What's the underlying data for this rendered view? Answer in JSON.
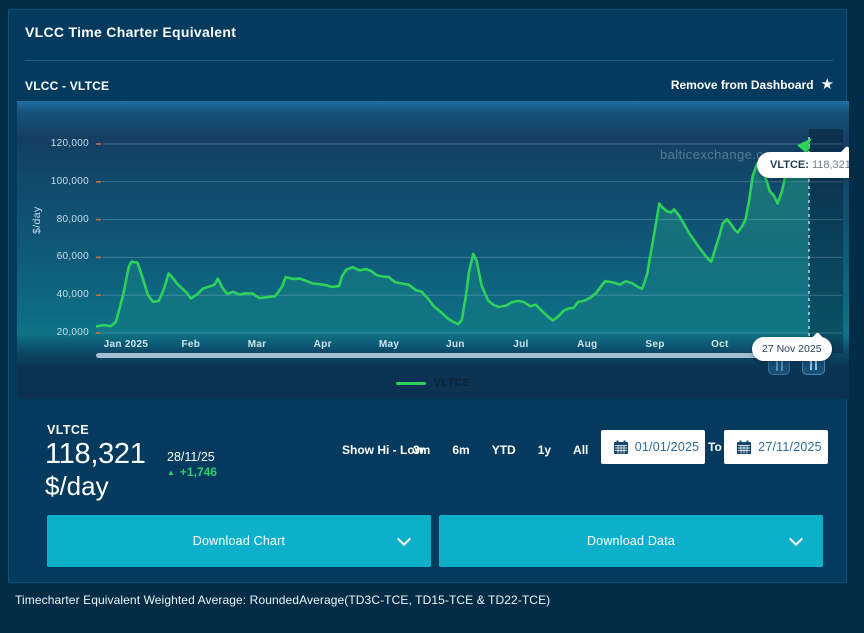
{
  "window": {
    "title": "VLCC Time Charter Equivalent"
  },
  "header": {
    "subtitle": "VLCC - VLTCE",
    "remove_label": "Remove from Dashboard",
    "star_icon": "★"
  },
  "chart_data": {
    "type": "line",
    "ylabel": "$/day",
    "ylim": [
      20000,
      120000
    ],
    "y_ticks": [
      20000,
      40000,
      60000,
      80000,
      100000,
      120000
    ],
    "x_ticks": [
      {
        "label": "Jan 2025",
        "f": 0.042
      },
      {
        "label": "Feb",
        "f": 0.133
      },
      {
        "label": "Mar",
        "f": 0.226
      },
      {
        "label": "Apr",
        "f": 0.318
      },
      {
        "label": "May",
        "f": 0.411
      },
      {
        "label": "Jun",
        "f": 0.504
      },
      {
        "label": "Jul",
        "f": 0.596
      },
      {
        "label": "Aug",
        "f": 0.689
      },
      {
        "label": "Sep",
        "f": 0.784
      },
      {
        "label": "Oct",
        "f": 0.875
      }
    ],
    "grid": true,
    "legend_position": "bottom",
    "watermark": "balticexchange.com",
    "line_color": "#2ed159",
    "area_color": "#2ed695",
    "tick_color": "#c4703f",
    "cursor_date": "27 Nov 2025",
    "tooltip": {
      "label": "VLTCE:",
      "value": "118,321"
    },
    "series": [
      {
        "name": "VLTCE",
        "points": [
          [
            0.0,
            23500
          ],
          [
            0.011,
            24200
          ],
          [
            0.021,
            23600
          ],
          [
            0.028,
            26000
          ],
          [
            0.038,
            40000
          ],
          [
            0.046,
            55000
          ],
          [
            0.05,
            57800
          ],
          [
            0.058,
            57200
          ],
          [
            0.063,
            52000
          ],
          [
            0.073,
            40000
          ],
          [
            0.08,
            36500
          ],
          [
            0.088,
            36900
          ],
          [
            0.095,
            43000
          ],
          [
            0.102,
            51500
          ],
          [
            0.108,
            49000
          ],
          [
            0.114,
            46000
          ],
          [
            0.121,
            43500
          ],
          [
            0.128,
            41000
          ],
          [
            0.133,
            38200
          ],
          [
            0.142,
            40500
          ],
          [
            0.15,
            43500
          ],
          [
            0.158,
            44500
          ],
          [
            0.166,
            45500
          ],
          [
            0.171,
            48800
          ],
          [
            0.177,
            44000
          ],
          [
            0.184,
            40600
          ],
          [
            0.192,
            41800
          ],
          [
            0.201,
            40300
          ],
          [
            0.21,
            41000
          ],
          [
            0.22,
            40800
          ],
          [
            0.229,
            38400
          ],
          [
            0.24,
            39000
          ],
          [
            0.251,
            39300
          ],
          [
            0.261,
            44500
          ],
          [
            0.266,
            49500
          ],
          [
            0.276,
            48600
          ],
          [
            0.286,
            48800
          ],
          [
            0.295,
            47500
          ],
          [
            0.304,
            46200
          ],
          [
            0.313,
            45800
          ],
          [
            0.323,
            45300
          ],
          [
            0.331,
            44400
          ],
          [
            0.341,
            44800
          ],
          [
            0.345,
            50000
          ],
          [
            0.351,
            53500
          ],
          [
            0.36,
            54800
          ],
          [
            0.369,
            53200
          ],
          [
            0.379,
            53800
          ],
          [
            0.386,
            52800
          ],
          [
            0.394,
            50500
          ],
          [
            0.404,
            49800
          ],
          [
            0.411,
            49600
          ],
          [
            0.419,
            47000
          ],
          [
            0.429,
            46200
          ],
          [
            0.439,
            45500
          ],
          [
            0.449,
            42600
          ],
          [
            0.457,
            41800
          ],
          [
            0.466,
            38000
          ],
          [
            0.474,
            34000
          ],
          [
            0.484,
            31000
          ],
          [
            0.494,
            27500
          ],
          [
            0.501,
            26000
          ],
          [
            0.508,
            24600
          ],
          [
            0.513,
            27000
          ],
          [
            0.519,
            40000
          ],
          [
            0.523,
            52000
          ],
          [
            0.529,
            61800
          ],
          [
            0.534,
            58000
          ],
          [
            0.541,
            45000
          ],
          [
            0.55,
            37200
          ],
          [
            0.557,
            35000
          ],
          [
            0.565,
            33800
          ],
          [
            0.575,
            34500
          ],
          [
            0.583,
            36200
          ],
          [
            0.592,
            37000
          ],
          [
            0.6,
            36400
          ],
          [
            0.609,
            34200
          ],
          [
            0.617,
            35000
          ],
          [
            0.626,
            31500
          ],
          [
            0.634,
            28600
          ],
          [
            0.641,
            26600
          ],
          [
            0.649,
            29000
          ],
          [
            0.656,
            31800
          ],
          [
            0.663,
            33000
          ],
          [
            0.67,
            33300
          ],
          [
            0.676,
            36400
          ],
          [
            0.684,
            37000
          ],
          [
            0.693,
            38600
          ],
          [
            0.701,
            41000
          ],
          [
            0.708,
            44500
          ],
          [
            0.714,
            47400
          ],
          [
            0.722,
            47000
          ],
          [
            0.729,
            46400
          ],
          [
            0.735,
            45600
          ],
          [
            0.743,
            47400
          ],
          [
            0.752,
            46400
          ],
          [
            0.76,
            44400
          ],
          [
            0.766,
            43400
          ],
          [
            0.773,
            51000
          ],
          [
            0.778,
            62000
          ],
          [
            0.784,
            75000
          ],
          [
            0.79,
            88500
          ],
          [
            0.795,
            86200
          ],
          [
            0.801,
            84400
          ],
          [
            0.806,
            83800
          ],
          [
            0.811,
            85400
          ],
          [
            0.818,
            82000
          ],
          [
            0.825,
            77500
          ],
          [
            0.832,
            72800
          ],
          [
            0.839,
            69000
          ],
          [
            0.846,
            65200
          ],
          [
            0.853,
            61800
          ],
          [
            0.858,
            59400
          ],
          [
            0.863,
            57600
          ],
          [
            0.868,
            64000
          ],
          [
            0.874,
            71000
          ],
          [
            0.879,
            78000
          ],
          [
            0.885,
            80200
          ],
          [
            0.891,
            77400
          ],
          [
            0.896,
            74600
          ],
          [
            0.9,
            73200
          ],
          [
            0.906,
            76400
          ],
          [
            0.911,
            80000
          ],
          [
            0.916,
            90000
          ],
          [
            0.921,
            103000
          ],
          [
            0.927,
            109500
          ],
          [
            0.934,
            108000
          ],
          [
            0.94,
            101000
          ],
          [
            0.945,
            95000
          ],
          [
            0.951,
            92500
          ],
          [
            0.956,
            88500
          ],
          [
            0.962,
            95000
          ],
          [
            0.968,
            105000
          ],
          [
            0.973,
            111000
          ],
          [
            0.98,
            112500
          ],
          [
            0.987,
            113500
          ],
          [
            0.993,
            115000
          ],
          [
            1.0,
            118321
          ]
        ]
      }
    ]
  },
  "legend": {
    "label": "VLTCE"
  },
  "stats": {
    "name": "VLTCE",
    "value": "118,321",
    "unit": "$/day",
    "date": "28/11/25",
    "up_triangle": "▲",
    "change": "+1,746",
    "change_color": "#2bd06b"
  },
  "controls": {
    "show_hilow": "Show Hi - Low",
    "ranges": [
      "3m",
      "6m",
      "YTD",
      "1y",
      "All"
    ],
    "date_from": "01/01/2025",
    "to_label": "To",
    "date_to": "27/11/2025"
  },
  "buttons": {
    "download_chart": "Download Chart",
    "download_data": "Download Data"
  },
  "footer": {
    "note": "Timecharter Equivalent Weighted Average: RoundedAverage(TD3C-TCE, TD15-TCE & TD22-TCE)"
  }
}
